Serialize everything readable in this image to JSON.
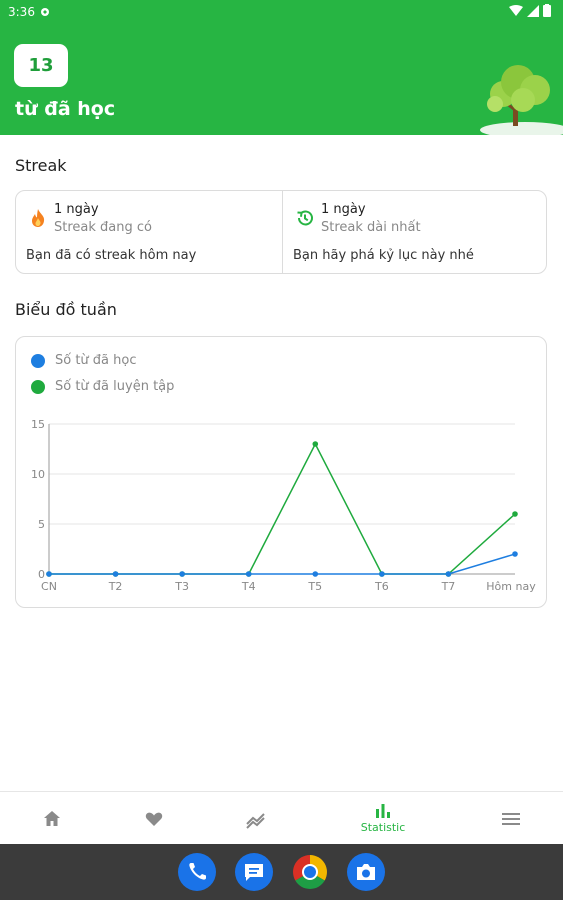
{
  "status_bar": {
    "time": "3:36"
  },
  "header": {
    "word_count": "13",
    "learned_label": "từ đã học"
  },
  "streak": {
    "title": "Streak",
    "current": {
      "value": "1 ngày",
      "label": "Streak đang có",
      "message": "Bạn đã có streak hôm nay",
      "icon": "flame-icon"
    },
    "longest": {
      "value": "1 ngày",
      "label": "Streak dài nhất",
      "message": "Bạn hãy phá kỷ lục này nhé",
      "icon": "history-icon"
    }
  },
  "weekly": {
    "title": "Biểu đồ tuần",
    "legend": [
      {
        "label": "Số từ đã học",
        "color": "#1e7ee0"
      },
      {
        "label": "Số từ đã luyện tập",
        "color": "#1faa3e"
      }
    ]
  },
  "chart_data": {
    "type": "line",
    "categories": [
      "CN",
      "T2",
      "T3",
      "T4",
      "T5",
      "T6",
      "T7",
      "Hôm nay"
    ],
    "series": [
      {
        "name": "Số từ đã học",
        "color": "#1e7ee0",
        "values": [
          0,
          0,
          0,
          0,
          0,
          0,
          0,
          2
        ]
      },
      {
        "name": "Số từ đã luyện tập",
        "color": "#1faa3e",
        "values": [
          0,
          0,
          0,
          0,
          13,
          0,
          0,
          6
        ]
      }
    ],
    "y_ticks": [
      "0",
      "5",
      "10",
      "15"
    ],
    "ylim": [
      0,
      15
    ],
    "grid": true,
    "legend_position": "top-left"
  },
  "bottom_nav": {
    "items": [
      {
        "icon": "home-icon"
      },
      {
        "icon": "heart-icon"
      },
      {
        "icon": "trend-icon"
      },
      {
        "icon": "bar-chart-icon",
        "label": "Statistic",
        "active": true
      },
      {
        "icon": "menu-icon"
      }
    ]
  },
  "dock": {
    "apps": [
      "phone-icon",
      "messages-icon",
      "chrome-icon",
      "camera-icon"
    ]
  },
  "colors": {
    "brand_green": "#27b543",
    "blue": "#1e7ee0",
    "green_line": "#1faa3e"
  }
}
